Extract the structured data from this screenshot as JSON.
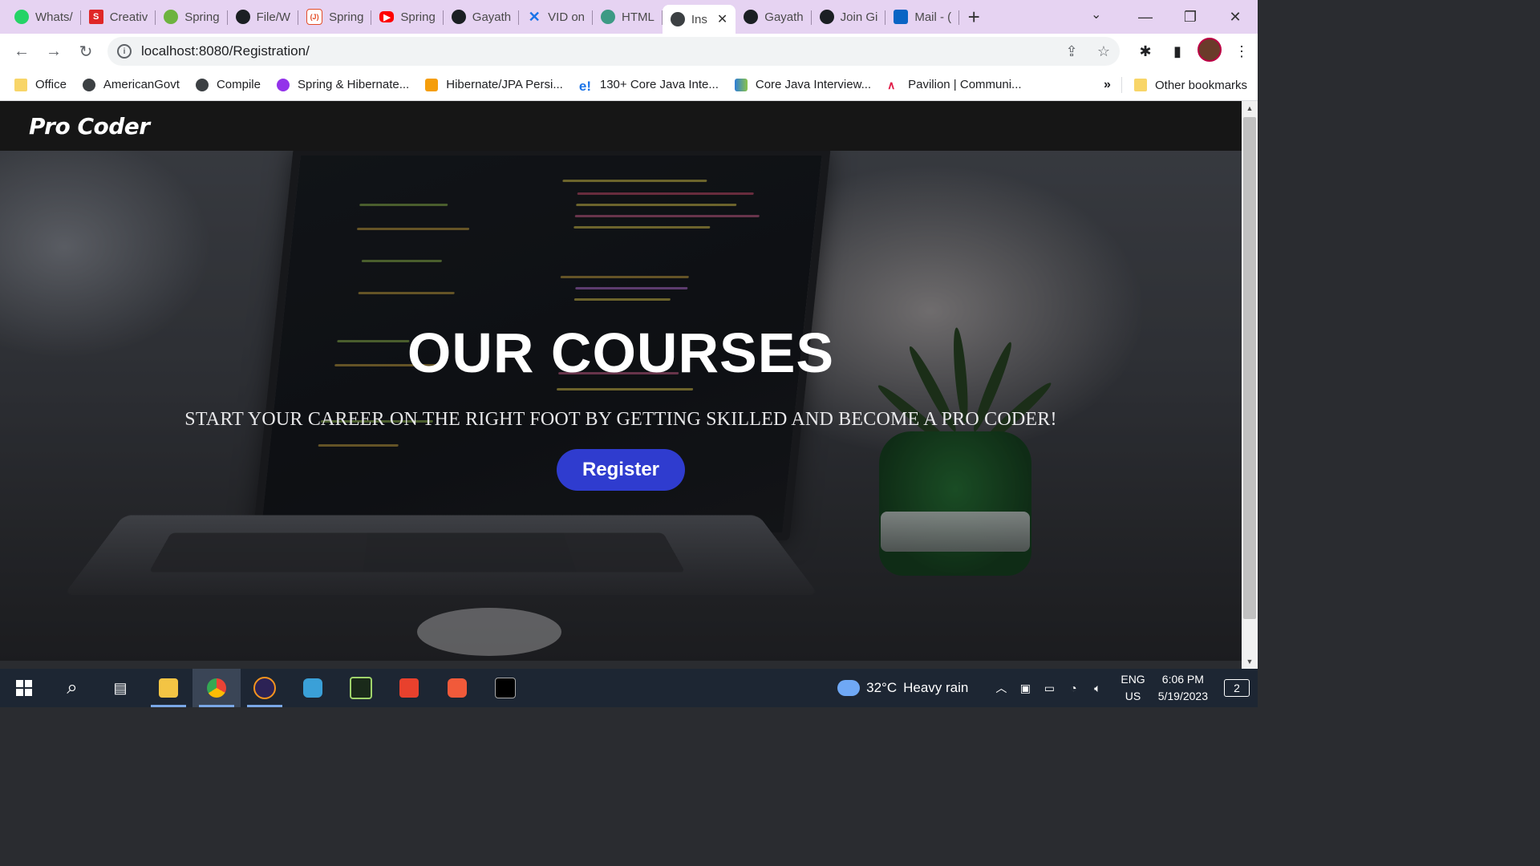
{
  "browser": {
    "tabs": [
      {
        "title": "Whats/",
        "icon": "whatsapp-icon"
      },
      {
        "title": "Creativ",
        "icon": "s-icon"
      },
      {
        "title": "Spring",
        "icon": "spring-icon"
      },
      {
        "title": "File/W",
        "icon": "github-icon"
      },
      {
        "title": "Spring",
        "icon": "j-icon"
      },
      {
        "title": "Spring",
        "icon": "youtube-icon"
      },
      {
        "title": "Gayath",
        "icon": "github-icon"
      },
      {
        "title": "VID on",
        "icon": "vid-icon"
      },
      {
        "title": "HTML",
        "icon": "chatgpt-icon"
      },
      {
        "title": "Ins",
        "icon": "globe-icon",
        "active": true
      },
      {
        "title": "Gayath",
        "icon": "github-icon"
      },
      {
        "title": "Join Gi",
        "icon": "github-icon"
      },
      {
        "title": "Mail - (",
        "icon": "outlook-icon"
      }
    ],
    "url": "localhost:8080/Registration/",
    "bookmarks": [
      {
        "label": "Office",
        "icon": "folder-icon"
      },
      {
        "label": "AmericanGovt",
        "icon": "globe-icon"
      },
      {
        "label": "Compile",
        "icon": "globe-icon"
      },
      {
        "label": "Spring & Hibernate...",
        "icon": "purple-icon"
      },
      {
        "label": "Hibernate/JPA Persi...",
        "icon": "code-icon"
      },
      {
        "label": "130+ Core Java Inte...",
        "icon": "e-icon"
      },
      {
        "label": "Core Java Interview...",
        "icon": "chart-icon"
      },
      {
        "label": "Pavilion | Communi...",
        "icon": "pavilion-icon"
      }
    ],
    "bookmarks_more": "»",
    "other_bookmarks": "Other bookmarks"
  },
  "site": {
    "brand": "Pro Coder",
    "hero_title": "OUR COURSES",
    "hero_subtitle": "START YOUR CAREER ON THE RIGHT FOOT BY GETTING SKILLED AND BECOME A PRO CODER!",
    "register_label": "Register"
  },
  "taskbar": {
    "weather_temp": "32°C",
    "weather_text": "Heavy rain",
    "lang_top": "ENG",
    "lang_bottom": "US",
    "time": "6:06 PM",
    "date": "5/19/2023",
    "notifications": "2"
  },
  "colors": {
    "tabstrip": "#e6d3f2",
    "register_button": "#2f3ccf",
    "site_nav": "#161616",
    "taskbar": "#1d2633"
  }
}
